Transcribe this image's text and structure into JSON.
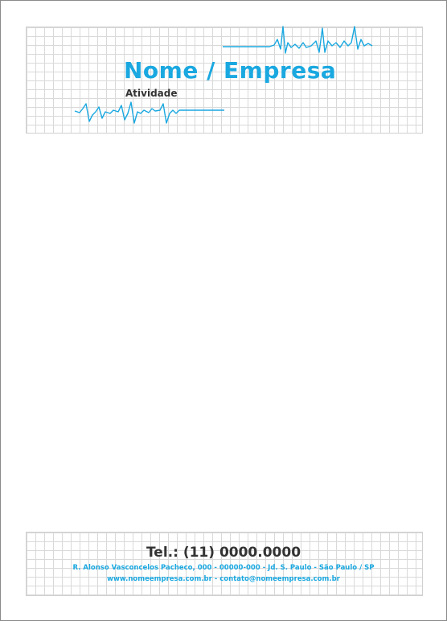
{
  "colors": {
    "accent": "#1aa8e0",
    "dark_text": "#333333",
    "grid": "#d9d9d9"
  },
  "header": {
    "company": "Nome / Empresa",
    "activity": "Atividade"
  },
  "footer": {
    "phone": "Tel.: (11) 0000.0000",
    "address": "R. Alonso Vasconcelos Pacheco, 000 - 00000-000 - Jd. S. Paulo - São Paulo / SP",
    "web": "www.nomeempresa.com.br - contato@nomeempresa.com.br"
  }
}
